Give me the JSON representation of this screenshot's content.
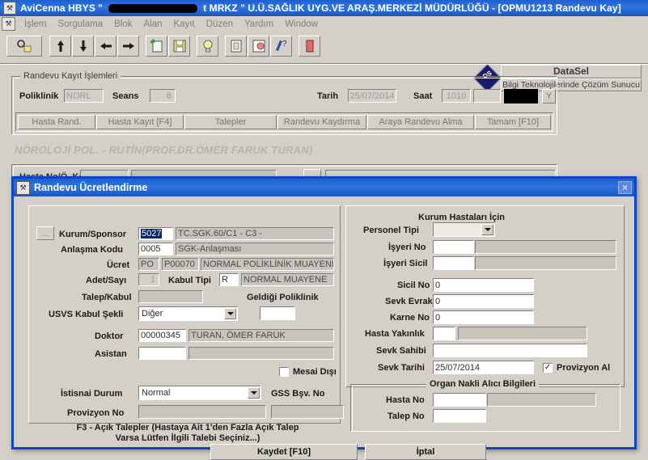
{
  "window": {
    "title_prefix": "AviCenna HBYS \"",
    "title_redacted": true,
    "title_suffix": "t MRKZ \" U.Ü.SAĞLIK UYG.VE ARAŞ.MERKEZİ MÜDÜRLÜĞÜ - [OPMU1213 Randevu Kay]",
    "app_icon": "avicenna-icon"
  },
  "menu": {
    "items": [
      "İşlem",
      "Sorgulama",
      "Blok",
      "Alan",
      "Kayıt",
      "Düzen",
      "Yardım",
      "Window"
    ]
  },
  "toolbar": {
    "buttons": [
      {
        "name": "query-icon"
      },
      {
        "name": "up-arrow-icon"
      },
      {
        "name": "down-arrow-icon"
      },
      {
        "name": "left-arrow-icon"
      },
      {
        "name": "right-arrow-icon"
      },
      {
        "name": "new-record-icon"
      },
      {
        "name": "save-icon"
      },
      {
        "name": "bulb-icon"
      },
      {
        "name": "list-icon"
      },
      {
        "name": "print-icon"
      },
      {
        "name": "help-icon"
      },
      {
        "name": "exit-icon"
      }
    ]
  },
  "brand": {
    "name": "DataSel",
    "slogan": "Bilgi Teknolojilerinde Çözüm Sunucu",
    "logo": "datasel-diamond-logo"
  },
  "form": {
    "groupbox_title": "Randevu Kayıt İşlemleri",
    "poliklinik_label": "Poliklinik",
    "poliklinik_value": "NORL",
    "seans_label": "Seans",
    "seans_value": "6",
    "tarih_label": "Tarih",
    "tarih_value": "25/07/2014",
    "saat_label": "Saat",
    "saat_value": "1010",
    "saat_extra_value": "",
    "redacted_box": true,
    "y_button": "Y",
    "action_buttons": [
      "Hasta Rand.",
      "Hasta Kayıt [F4]",
      "Talepler",
      "Randevu Kaydırma",
      "Araya Randevu Alma",
      "Tamam [F10]"
    ],
    "watermark": "NÖROLOJİ POL. - RUTİN(PROF.DR.ÖMER FARUK TURAN)",
    "behind_label": "Hasta No/Ö. Kayıt"
  },
  "dialog": {
    "title": "Randevu Ücretlendirme",
    "icon": "dialog-icon",
    "close": "×",
    "left": {
      "kurum_sponsor_label": "Kurum/Sponsor",
      "kurum_sponsor_code": "5027",
      "kurum_sponsor_name": "TC.SGK.60/C1 - C3 -",
      "browse_button": "...",
      "anlasma_kodu_label": "Anlaşma Kodu",
      "anlasma_kodu_code": "0005",
      "anlasma_kodu_name": "SGK-Anlaşması",
      "ucret_label": "Ücret",
      "ucret_prefix": "PO",
      "ucret_code": "P00070",
      "ucret_name": "NORMAL POLİKLİNİK MUAYENESİ",
      "adet_sayi_label": "Adet/Sayı",
      "adet_sayi_value": "1",
      "kabul_tipi_label": "Kabul Tipi",
      "kabul_tipi_code": "R",
      "kabul_tipi_name": "NORMAL MUAYENE",
      "talep_kabul_label": "Talep/Kabul",
      "talep_kabul_value": "",
      "geldigi_poliklinik_label": "Geldiği Poliklinik",
      "geldigi_poliklinik_value": "",
      "usvs_kabul_sekli_label": "USVS Kabul Şekli",
      "usvs_kabul_sekli_value": "Diğer",
      "doktor_label": "Doktor",
      "doktor_code": "00000345",
      "doktor_name": "TURAN, ÖMER FARUK",
      "asistan_label": "Asistan",
      "asistan_code": "",
      "asistan_name": "",
      "mesai_disi_label": "Mesai Dışı",
      "mesai_disi_checked": false,
      "istisnai_durum_label": "İstisnai Durum",
      "istisnai_durum_value": "Normal",
      "gss_bsv_no_label": "GSS Bşv. No",
      "gss_bsv_no_value": "",
      "provizyon_no_label": "Provizyon No",
      "provizyon_no_value": "",
      "note_line1": "F3 - Açık Talepler (Hastaya Ait 1'den Fazla Açık Talep",
      "note_line2": "Varsa Lütfen İlgili Talebi Seçiniz...)"
    },
    "right": {
      "section_title": "Kurum Hastaları İçin",
      "personel_tipi_label": "Personel Tipi",
      "personel_tipi_value": "",
      "isyeri_no_label": "İşyeri No",
      "isyeri_no_value": "",
      "isyeri_no_name": "",
      "isyeri_sicil_label": "İşyeri Sicil",
      "isyeri_sicil_value": "",
      "isyeri_sicil_name": "",
      "sicil_no_label": "Sicil No",
      "sicil_no_value": "0",
      "sevk_evrak_label": "Sevk Evrak",
      "sevk_evrak_value": "0",
      "karne_no_label": "Karne No",
      "karne_no_value": "0",
      "hasta_yakinlik_label": "Hasta Yakınlık",
      "hasta_yakinlik_code": "",
      "hasta_yakinlik_name": "",
      "sevk_sahibi_label": "Sevk Sahibi",
      "sevk_sahibi_value": "",
      "sevk_tarihi_label": "Sevk Tarihi",
      "sevk_tarihi_value": "25/07/2014",
      "provizyon_al_label": "Provizyon Al",
      "provizyon_al_checked": true,
      "organ_section_title": "Organ Nakli Alıcı Bilgileri",
      "hasta_no_label": "Hasta No",
      "hasta_no_value": "",
      "hasta_no_name": "",
      "talep_no_label": "Talep No",
      "talep_no_value": ""
    },
    "buttons": {
      "save": "Kaydet [F10]",
      "cancel": "İptal"
    }
  }
}
